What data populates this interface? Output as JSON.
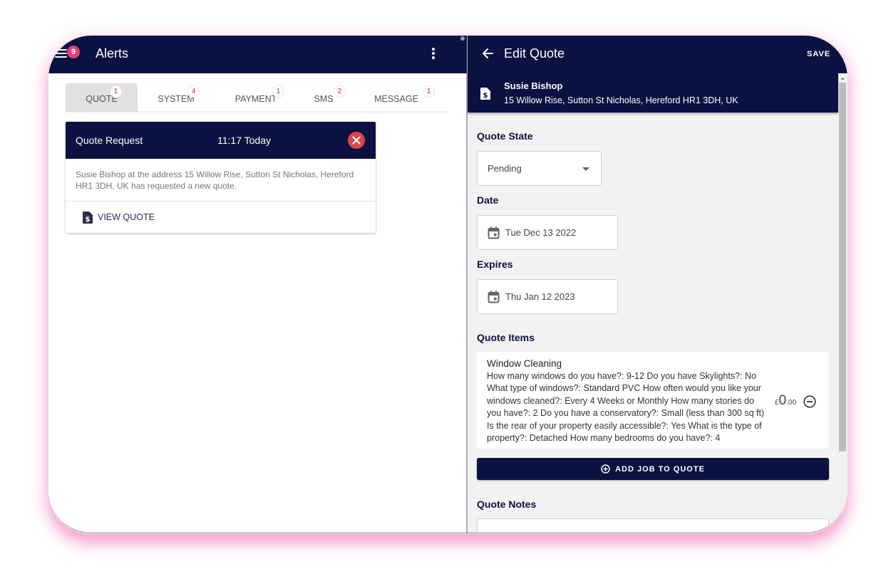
{
  "left": {
    "title": "Alerts",
    "menu_badge": "9",
    "tabs": [
      {
        "label": "QUOTE",
        "count": "1",
        "active": true
      },
      {
        "label": "SYSTEM",
        "count": "4"
      },
      {
        "label": "PAYMENT",
        "count": "1"
      },
      {
        "label": "SMS",
        "count": "2"
      },
      {
        "label": "MESSAGE",
        "count": "1"
      }
    ],
    "card": {
      "title": "Quote Request",
      "time": "11:17 Today",
      "body": "Susie Bishop at the address 15 Willow Rise, Sutton St Nicholas, Hereford HR1 3DH, UK has requested a new quote.",
      "action": "VIEW QUOTE"
    }
  },
  "right": {
    "title": "Edit Quote",
    "save_label": "SAVE",
    "customer": {
      "name": "Susie Bishop",
      "address": "15 Willow Rise, Sutton St Nicholas, Hereford HR1 3DH, UK"
    },
    "quote_state": {
      "label": "Quote State",
      "value": "Pending"
    },
    "date": {
      "label": "Date",
      "value": "Tue Dec 13 2022"
    },
    "expires": {
      "label": "Expires",
      "value": "Thu Jan 12 2023"
    },
    "items_label": "Quote Items",
    "items": [
      {
        "title": "Window Cleaning",
        "description": "How many windows do you have?: 9-12 Do you have Skylights?: No What type of windows?: Standard PVC How often would you like your windows cleaned?: Every 4 Weeks or Monthly How many stories do you have?: 2 Do you have a conservatory?: Small (less than 300 sq ft) Is the rear of your property easily accessible?: Yes What is the type of property?: Detached How many bedrooms do you have?: 4",
        "currency": "£",
        "price_whole": "0",
        "price_cents": ".00"
      }
    ],
    "add_job_label": "ADD JOB TO QUOTE",
    "notes_label": "Quote Notes",
    "notes_value": ""
  },
  "colors": {
    "navy": "#0b1140",
    "badge": "#e0407a",
    "close": "#e0454e",
    "count_text": "#d0203a"
  }
}
